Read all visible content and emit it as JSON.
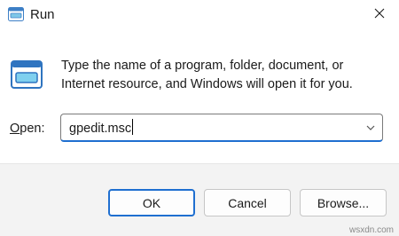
{
  "window": {
    "title": "Run",
    "title_icon": "run-app-icon",
    "close_icon": "close-icon"
  },
  "content": {
    "icon": "run-dialog-icon",
    "message": "Type the name of a program, folder, document, or Internet resource, and Windows will open it for you.",
    "open_label_mnemonic": "O",
    "open_label_rest": "pen:",
    "open_value": "gpedit.msc",
    "dropdown_icon": "chevron-down-icon"
  },
  "buttons": {
    "ok": "OK",
    "cancel": "Cancel",
    "browse": "Browse..."
  },
  "watermark": "wsxdn.com",
  "colors": {
    "accent": "#1f6fd0",
    "footer_bg": "#f3f3f3",
    "window_bg": "#ffffff"
  }
}
